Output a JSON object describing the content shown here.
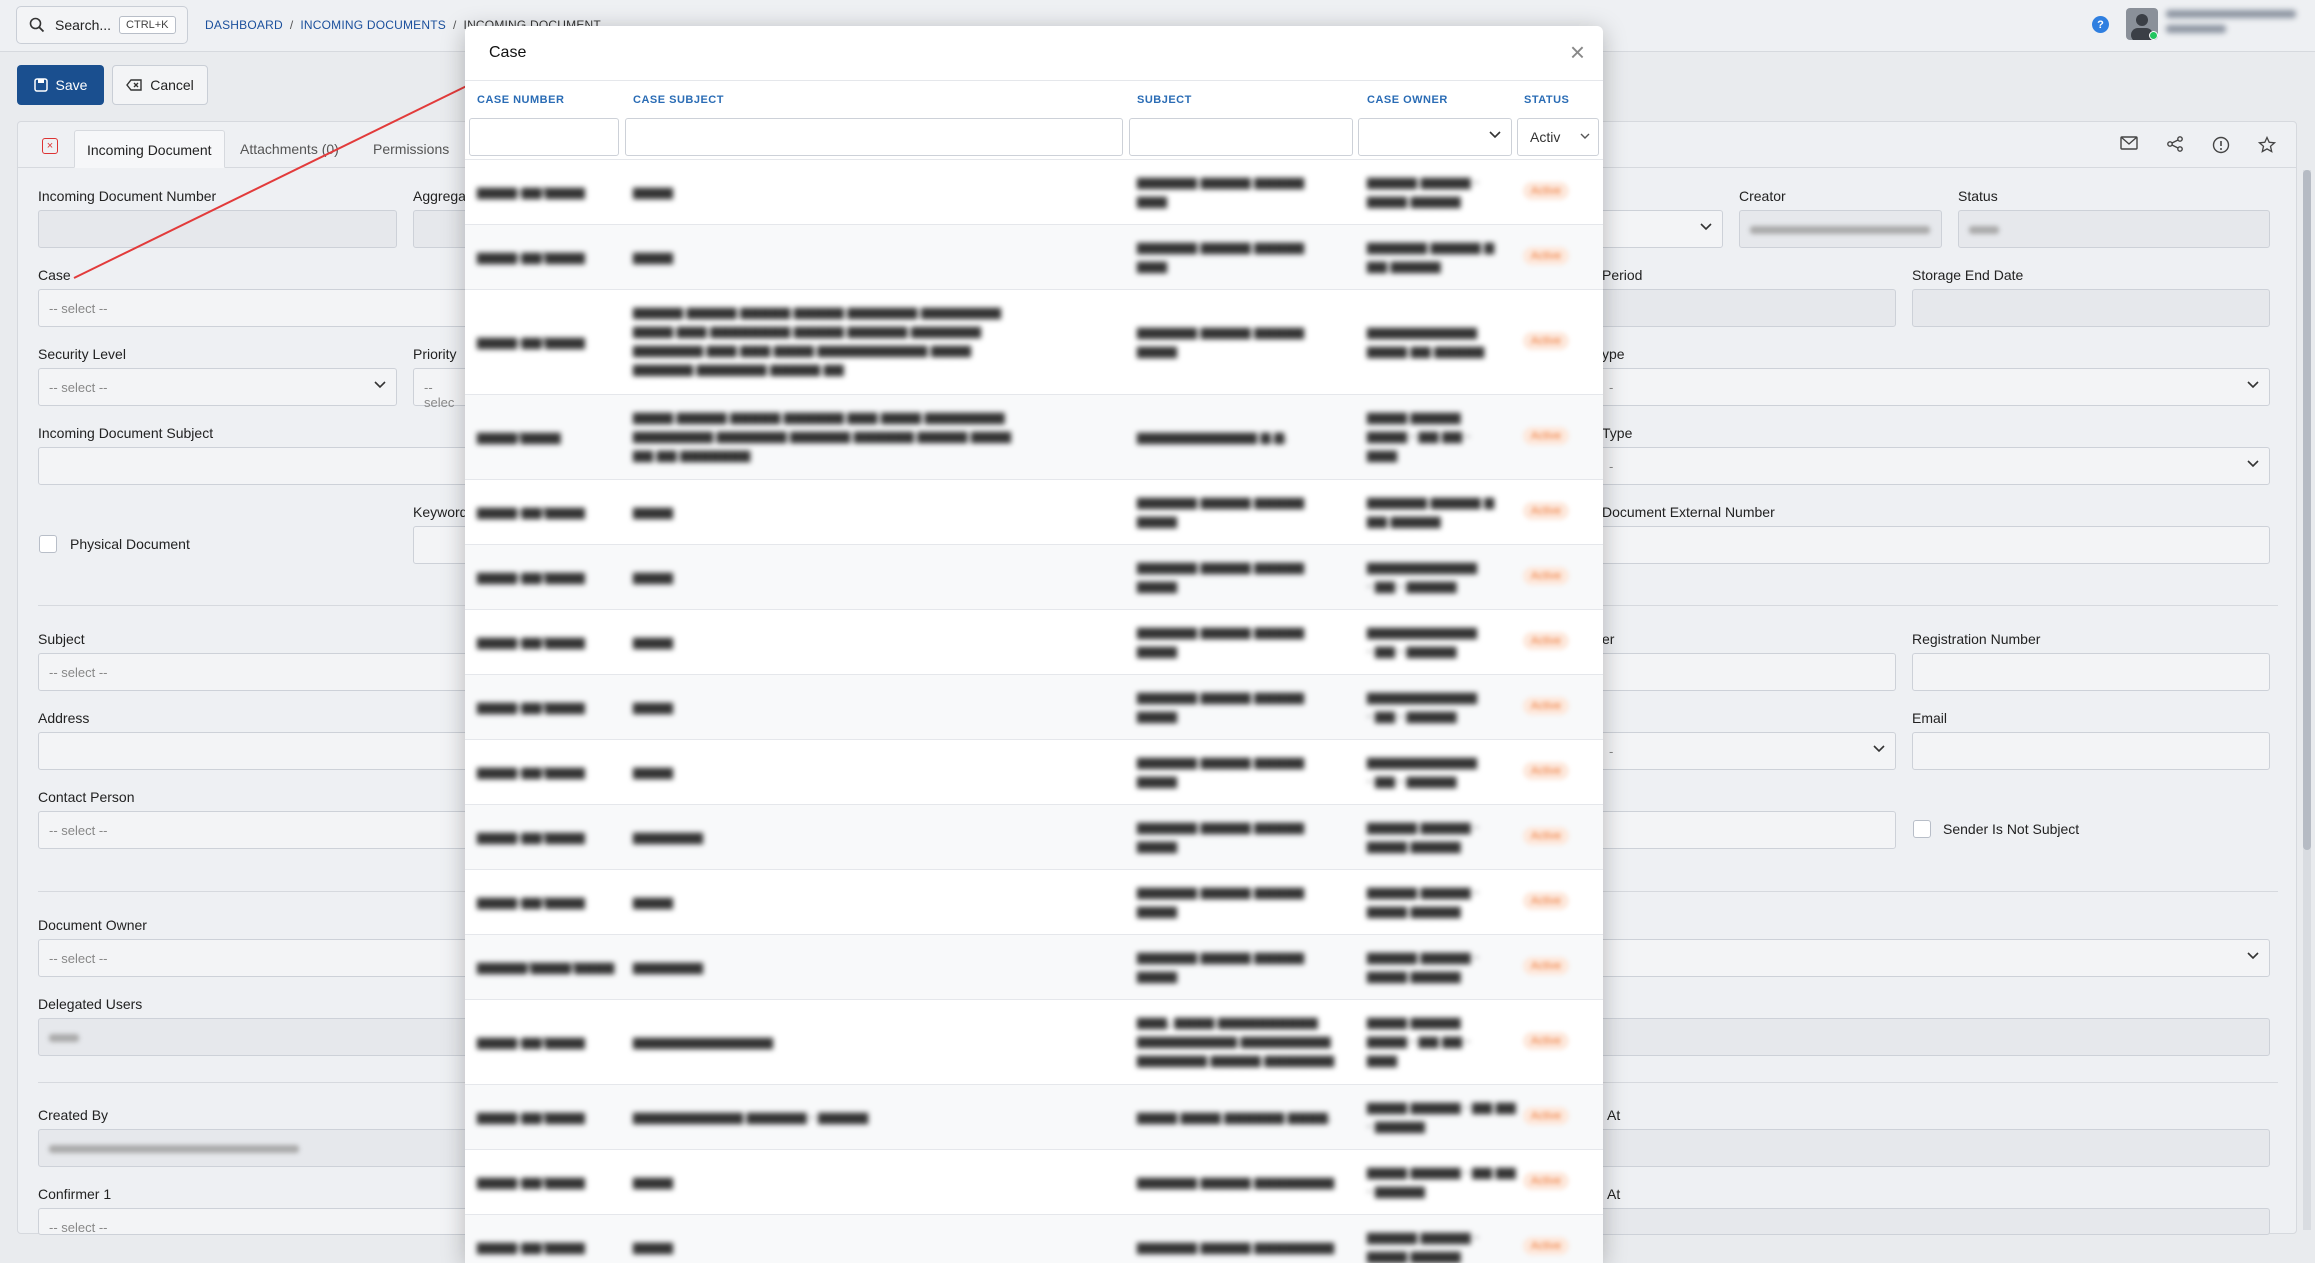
{
  "topbar": {
    "search_label": "Search...",
    "search_shortcut": "CTRL+K",
    "breadcrumb": [
      "DASHBOARD",
      "INCOMING DOCUMENTS",
      "INCOMING DOCUMENT"
    ],
    "help": "?"
  },
  "toolbar": {
    "save_label": "Save",
    "cancel_label": "Cancel"
  },
  "tabs": [
    {
      "label": "Incoming Document",
      "active": true
    },
    {
      "label": "Attachments (0)",
      "active": false
    },
    {
      "label": "Permissions",
      "active": false
    }
  ],
  "form": {
    "incoming_document_number": "Incoming Document Number",
    "aggregate_partial": "Aggrega",
    "creator": "Creator",
    "status": "Status",
    "case": "Case",
    "case_placeholder": "-- select --",
    "period_partial": "Period",
    "storage_end_date": "Storage End Date",
    "security_level": "Security Level",
    "security_level_placeholder": "-- select --",
    "priority_partial": "Priority",
    "priority_placeholder_partial": "-- selec",
    "type_partial_1": "ype",
    "incoming_document_subject": "Incoming Document Subject",
    "type_partial_2": "Type",
    "physical_document": "Physical Document",
    "keyword_partial": "Keyword",
    "document_external_number_partial": "Document External Number",
    "subject": "Subject",
    "subject_placeholder": "-- select --",
    "er_partial": "er",
    "registration_number": "Registration Number",
    "address": "Address",
    "email": "Email",
    "contact_person": "Contact Person",
    "contact_person_placeholder": "-- select --",
    "sender_is_not_subject": "Sender Is Not Subject",
    "document_owner": "Document Owner",
    "document_owner_placeholder": "-- select --",
    "delegated_users": "Delegated Users",
    "created_by": "Created By",
    "at_partial_1": "At",
    "confirmer_1": "Confirmer 1",
    "confirmer_1_placeholder": "-- select --",
    "at_partial_2": "At",
    "dash": "-"
  },
  "modal": {
    "title": "Case",
    "close": "×",
    "columns": [
      "CASE NUMBER",
      "CASE SUBJECT",
      "SUBJECT",
      "CASE OWNER",
      "STATUS"
    ],
    "status_filter": "Activ"
  }
}
